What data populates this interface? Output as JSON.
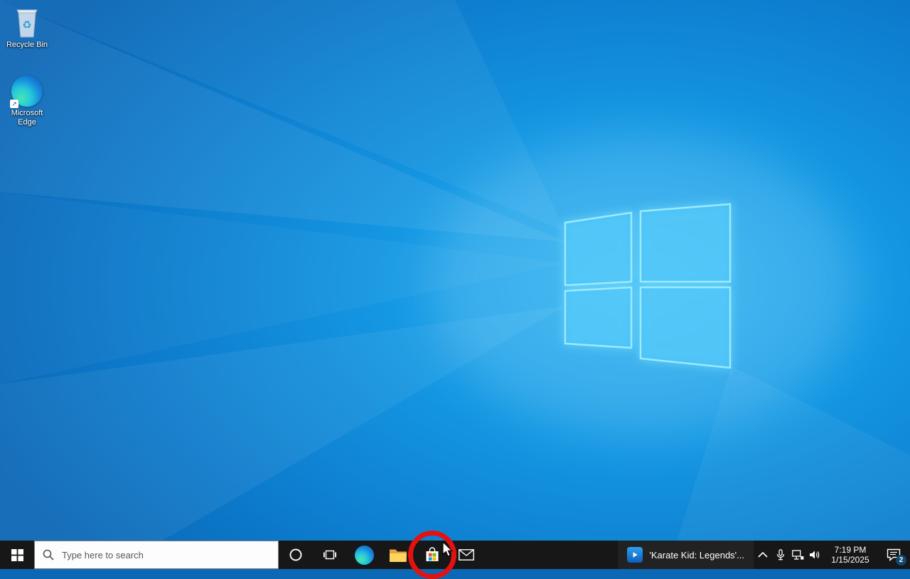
{
  "desktop": {
    "icons": [
      {
        "id": "recycle-bin",
        "label": "Recycle Bin"
      },
      {
        "id": "microsoft-edge",
        "label": "Microsoft Edge"
      }
    ]
  },
  "taskbar": {
    "search": {
      "placeholder": "Type here to search"
    },
    "buttons": [
      "start",
      "cortana",
      "task-view",
      "microsoft-edge",
      "file-explorer",
      "microsoft-store",
      "mail"
    ],
    "media": {
      "label": "'Karate Kid: Legends'..."
    },
    "tray": {
      "icons": [
        "hidden-icons-chevron",
        "microphone",
        "network",
        "volume"
      ],
      "time": "7:19 PM",
      "date": "1/15/2025",
      "notification_count": "2"
    }
  },
  "annotations": {
    "red_circle": {
      "target": "microsoft-store-button",
      "color": "#e31212"
    },
    "cursor_visible": true
  },
  "colors": {
    "taskbar_bg": "#171717",
    "wallpaper_base": "#0d7ccd",
    "logo_stroke": "#9beaff",
    "store_flag": [
      "#f25022",
      "#7fba00",
      "#00a4ef",
      "#ffb900"
    ]
  }
}
